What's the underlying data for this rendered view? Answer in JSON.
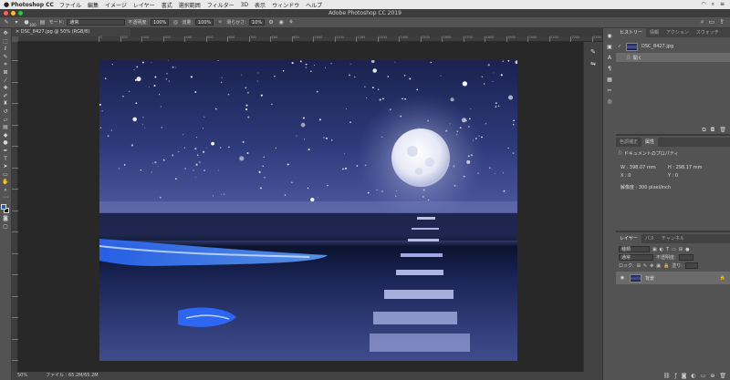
{
  "menubar": {
    "app_name": "Photoshop CC",
    "items": [
      "ファイル",
      "編集",
      "イメージ",
      "レイヤー",
      "書式",
      "選択範囲",
      "フィルター",
      "3D",
      "表示",
      "ウィンドウ",
      "ヘルプ"
    ]
  },
  "window": {
    "title": "Adobe Photoshop CC 2019"
  },
  "options": {
    "brush_size": "300",
    "mode_label": "モード:",
    "mode_value": "通常",
    "opacity_label": "不透明度:",
    "opacity_value": "100%",
    "flow_label": "流量:",
    "flow_value": "100%",
    "smoothing_label": "滑らかさ:",
    "smoothing_value": "10%"
  },
  "document": {
    "tab_title": "DSC_8427.jpg @ 50% (RGB/8)",
    "zoom": "50%",
    "file_info": "ファイル : 65.2M/65.2M"
  },
  "ruler_labels": [
    "0",
    "100",
    "200",
    "300",
    "400",
    "500",
    "600",
    "700",
    "800",
    "900",
    "1000",
    "1100",
    "1200",
    "1300",
    "1400",
    "1500",
    "1600",
    "1700",
    "1800",
    "1900",
    "2000",
    "2100",
    "2200",
    "2300",
    "2400",
    "2500",
    "2600",
    "2700"
  ],
  "history_panel": {
    "tabs": [
      "ヒストリー",
      "情報",
      "アクション",
      "スウォッチ"
    ],
    "snapshot": "DSC_8427.jpg",
    "step": "開く"
  },
  "properties_panel": {
    "tabs": [
      "色調補正",
      "属性"
    ],
    "title": "ドキュメントのプロパティ",
    "w": "W : 398.07 mm",
    "h": "H : 298.17 mm",
    "x": "X : 0",
    "y": "Y : 0",
    "resolution": "解像度 : 300 pixel/inch"
  },
  "layers_panel": {
    "tabs": [
      "レイヤー",
      "パス",
      "チャンネル"
    ],
    "filter": "種類",
    "blend": "通常",
    "opacity_label": "不透明度:",
    "lock_label": "ロック:",
    "fill_label": "塗り:",
    "layer_name": "背景"
  },
  "colors": {
    "foreground": "#1f5aa8",
    "background": "#1a1a1a"
  }
}
